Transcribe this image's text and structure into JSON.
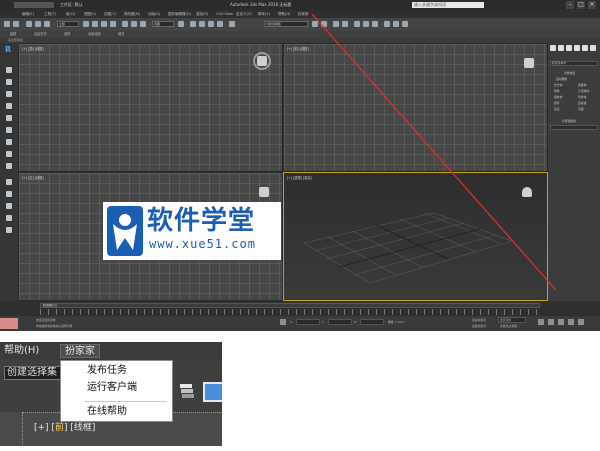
{
  "app": {
    "window_title": "Autodesk 3ds Max 2016    无标题",
    "quick_access_title": "工作区: 默认",
    "search_placeholder": "键入关键字或短语"
  },
  "menubar_items": [
    "编辑(E)",
    "工具(T)",
    "组(G)",
    "视图(V)",
    "创建(C)",
    "修改器(M)",
    "动画(A)",
    "图形编辑器(D)",
    "渲染(R)",
    "Civil View",
    "自定义(U)",
    "脚本(S)",
    "帮助(H)",
    "扮家家"
  ],
  "toolbar": {
    "filter_value": "全部",
    "view_value": "视图",
    "selection_set_value": "创建选择集"
  },
  "ribbon_items": [
    "建模",
    "自由形式",
    "选择",
    "对象绘制",
    "填充"
  ],
  "ribbon_sub": "多边形建模",
  "viewports": {
    "top": "[+] [顶] [线框]",
    "front": "[+] [前] [线框]",
    "left": "[+] [左] [线框]",
    "perspective": "[+] [透视] [真实]"
  },
  "command_panel": {
    "category": "标准基本体",
    "rollout_object_type": "对象类型",
    "autogrid": "自动栅格",
    "objects": [
      "长方体",
      "圆锥体",
      "球体",
      "几何球体",
      "圆柱体",
      "管状体",
      "圆环",
      "四棱锥",
      "茶壶",
      "平面"
    ],
    "rollout_name_color": "名称和颜色"
  },
  "timeline": {
    "thumb": "0 / 100",
    "ticks": [
      "0",
      "10",
      "20",
      "30",
      "40",
      "50",
      "60",
      "70",
      "80",
      "90",
      "100"
    ]
  },
  "statusbar": {
    "status_text": "未选定任何对象",
    "hint_text": "单击或单击并拖动以选择对象",
    "x_label": "X:",
    "y_label": "Y:",
    "z_label": "Z:",
    "grid": "栅格 = 10.0",
    "auto_key": "自动关键点",
    "selected": "选定对象",
    "set_key": "设置关键点",
    "key_filters": "关键点过滤器..."
  },
  "watermark": {
    "title": "软件学堂",
    "url": "www.xue51.com"
  },
  "zoom": {
    "menu_help": "帮助(H)",
    "menu_banjiajia": "扮家家",
    "selection_set": "创建选择集",
    "dropdown_items": [
      "发布任务",
      "运行客户端",
      "在线帮助"
    ],
    "viewport_label_prefix": "[+] [",
    "viewport_label_view": "前",
    "viewport_label_suffix": "] [线框]"
  },
  "colors": {
    "accent_blue": "#1b5fb4",
    "annotation_red": "#e0302a",
    "viewport_highlight": "#c9a400"
  }
}
